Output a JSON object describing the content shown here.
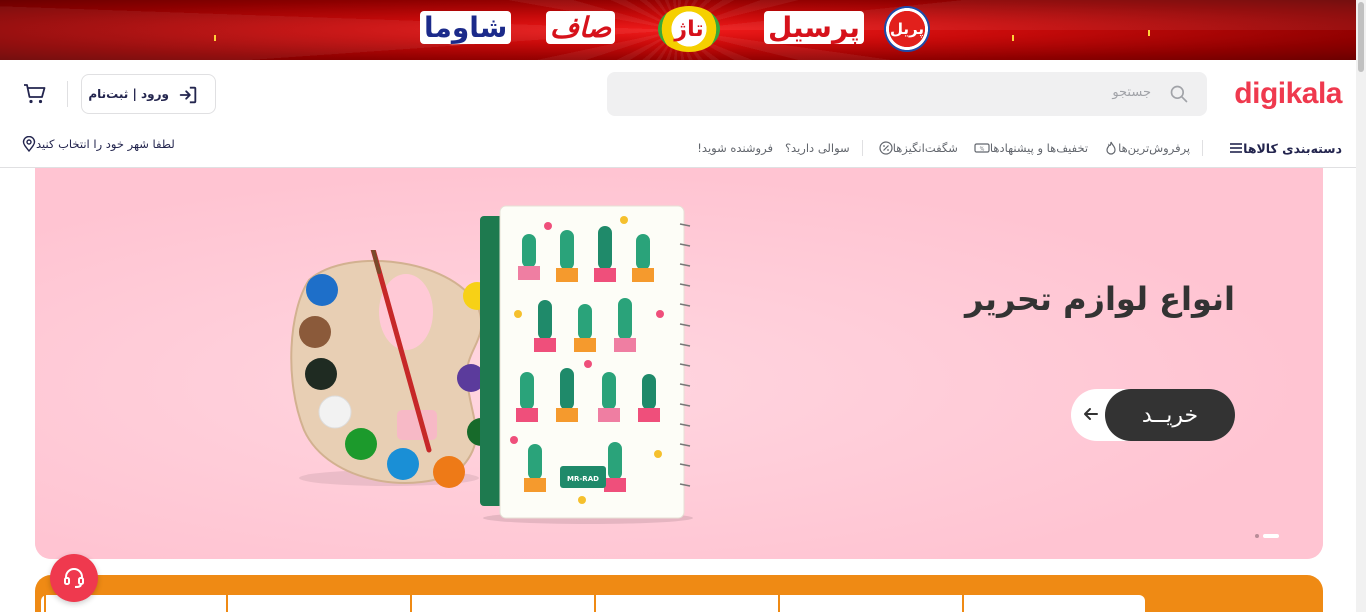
{
  "promo": {
    "brands": [
      "شاوما",
      "صاف",
      "تاژ",
      "پرسیل",
      "پریل"
    ]
  },
  "header": {
    "logo": "digikala",
    "search_placeholder": "جستجو",
    "login_label": "ورود | ثبت‌نام"
  },
  "nav": {
    "categories": "دسته‌بندی کالاها",
    "items": [
      "پرفروش‌ترین‌ها",
      "تخفیف‌ها و پیشنهادها",
      "شگفت‌انگیزها",
      "سوالی دارید؟",
      "فروشنده شوید!"
    ],
    "location": "لطفا شهر خود را انتخاب کنید"
  },
  "hero": {
    "title": "انواع لوازم تحریر",
    "cta": "خریــد",
    "notebook_label": "MR-RAD",
    "slides_total": 2,
    "active_slide": 1
  },
  "colors": {
    "brand": "#ef394e",
    "hero_bg": "#ffc9d6",
    "orange": "#ef8a14"
  },
  "icons": {
    "search": "search-icon",
    "login": "login-icon",
    "cart": "cart-icon",
    "menu": "hamburger-icon",
    "fire": "fire-icon",
    "coupon": "coupon-icon",
    "percent": "percent-icon",
    "location": "location-pin-icon",
    "support": "headset-icon",
    "arrow": "arrow-left-icon"
  }
}
